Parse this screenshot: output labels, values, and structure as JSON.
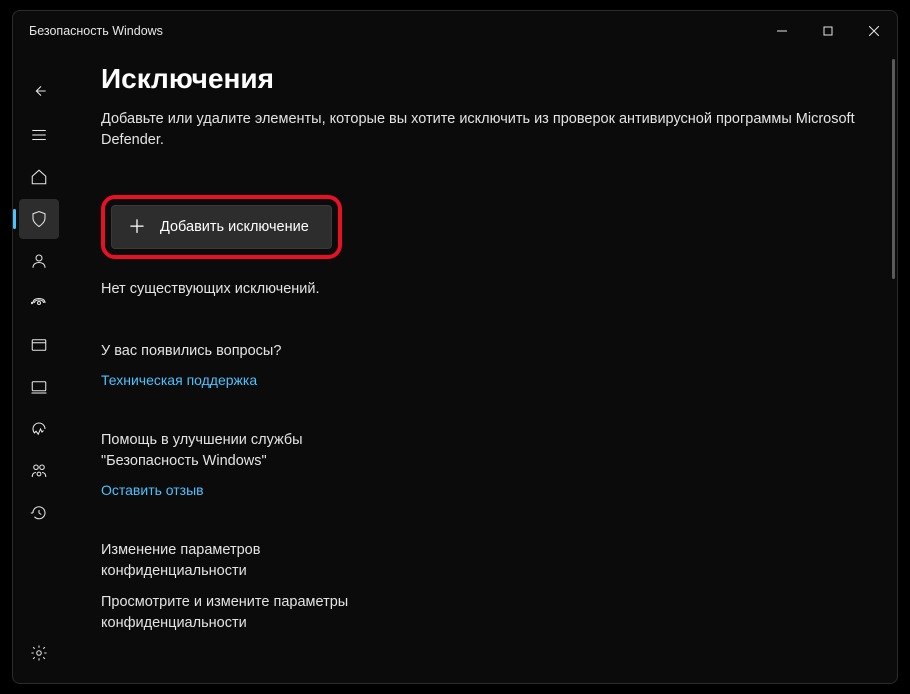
{
  "window": {
    "title": "Безопасность Windows"
  },
  "sidebar": {
    "items": [
      {
        "name": "menu-icon"
      },
      {
        "name": "home-icon"
      },
      {
        "name": "shield-icon"
      },
      {
        "name": "account-icon"
      },
      {
        "name": "firewall-icon"
      },
      {
        "name": "app-browser-icon"
      },
      {
        "name": "device-security-icon"
      },
      {
        "name": "device-performance-icon"
      },
      {
        "name": "family-icon"
      },
      {
        "name": "history-icon"
      }
    ]
  },
  "page": {
    "title": "Исключения",
    "description": "Добавьте или удалите элементы, которые вы хотите исключить из проверок антивирусной программы Microsoft Defender.",
    "add_button_label": "Добавить исключение",
    "empty_status": "Нет существующих исключений."
  },
  "help_section": {
    "heading": "У вас появились вопросы?",
    "link": "Техническая поддержка"
  },
  "feedback_section": {
    "heading": "Помощь в улучшении службы \"Безопасность Windows\"",
    "link": "Оставить отзыв"
  },
  "privacy_section": {
    "heading": "Изменение параметров конфиденциальности",
    "text": "Просмотрите и измените параметры конфиденциальности"
  }
}
